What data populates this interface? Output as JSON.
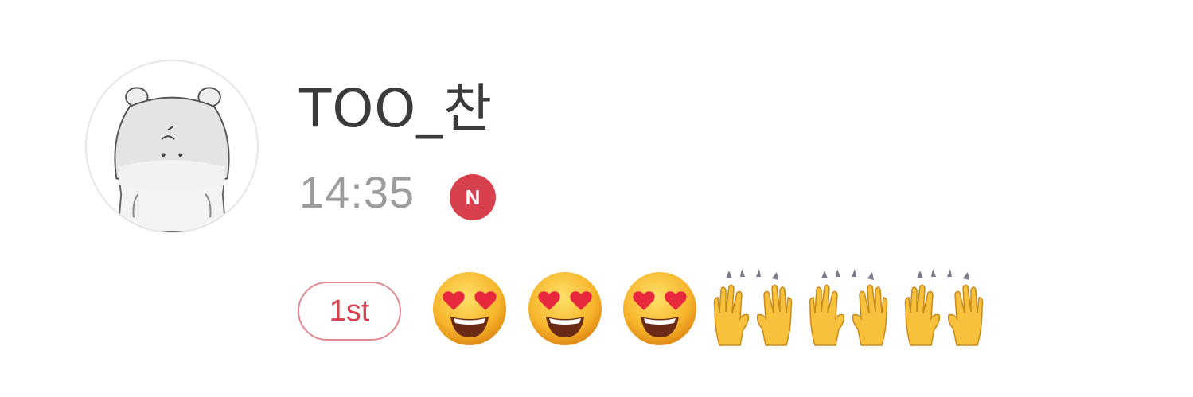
{
  "post": {
    "username": "TOO_찬",
    "time": "14:35",
    "new_badge": "N",
    "rank_badge": "1st",
    "avatar_icon": "cartoon-hamster-avatar",
    "emojis": [
      "heart-eyes-emoji",
      "heart-eyes-emoji",
      "heart-eyes-emoji",
      "raising-hands-emoji",
      "raising-hands-emoji",
      "raising-hands-emoji"
    ]
  },
  "colors": {
    "accent_red": "#d9404d",
    "badge_border": "#e28a92",
    "username_text": "#3b3b3b",
    "time_text": "#9c9c9c"
  }
}
